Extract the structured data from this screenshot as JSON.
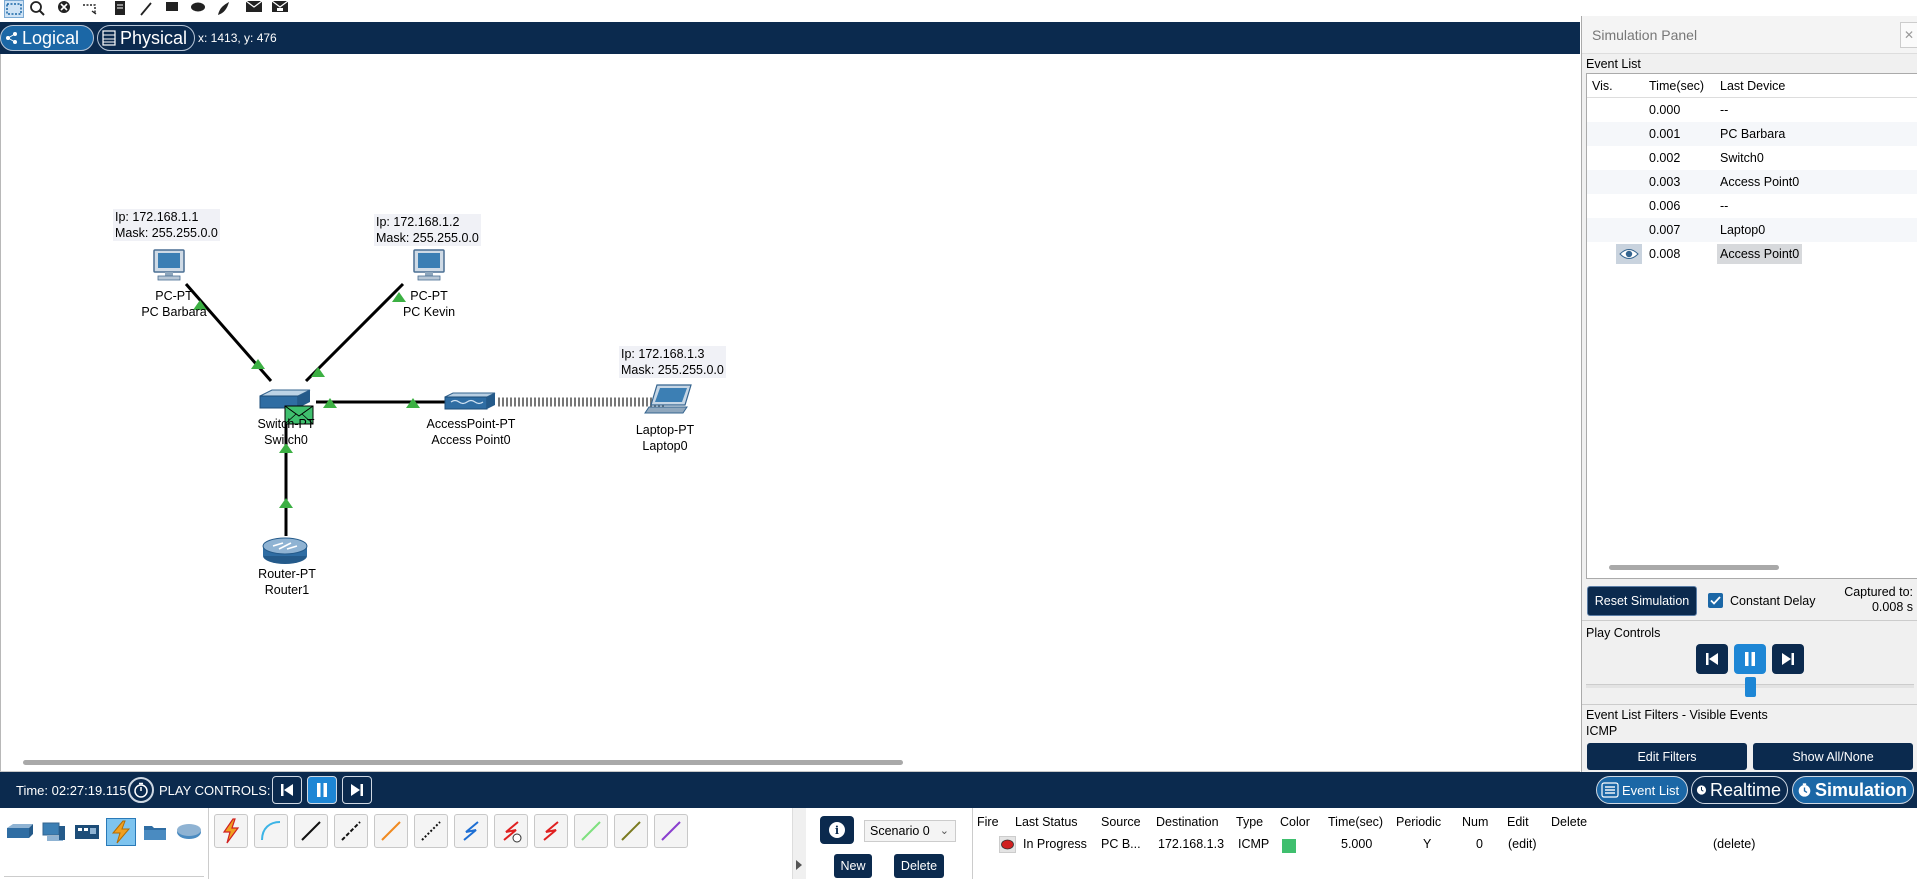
{
  "mode_bar": {
    "logical_label": "Logical",
    "physical_label": "Physical",
    "coords": "x: 1413, y: 476"
  },
  "topology": {
    "devices": [
      {
        "id": "pc-barbara",
        "type_label": "PC-PT",
        "name": "PC Barbara",
        "ip": "Ip: 172.168.1.1",
        "mask": "Mask: 255.255.0.0"
      },
      {
        "id": "pc-kevin",
        "type_label": "PC-PT",
        "name": "PC Kevin",
        "ip": "Ip: 172.168.1.2",
        "mask": "Mask: 255.255.0.0"
      },
      {
        "id": "switch0",
        "type_label": "Switch-PT",
        "name": "Switch0"
      },
      {
        "id": "access-point0",
        "type_label": "AccessPoint-PT",
        "name": "Access Point0"
      },
      {
        "id": "laptop0",
        "type_label": "Laptop-PT",
        "name": "Laptop0",
        "ip": "Ip: 172.168.1.3",
        "mask": "Mask: 255.255.0.0"
      },
      {
        "id": "router1",
        "type_label": "Router-PT",
        "name": "Router1"
      }
    ],
    "link_color": "#000000",
    "link_light_color": "#3cb043"
  },
  "sim_panel": {
    "title": "Simulation Panel",
    "close": "✕",
    "event_list_label": "Event List",
    "columns": {
      "vis": "Vis.",
      "time": "Time(sec)",
      "last_device": "Last Device"
    },
    "events": [
      {
        "time": "0.000",
        "last_device": "--"
      },
      {
        "time": "0.001",
        "last_device": "PC Barbara"
      },
      {
        "time": "0.002",
        "last_device": "Switch0"
      },
      {
        "time": "0.003",
        "last_device": "Access Point0"
      },
      {
        "time": "0.006",
        "last_device": "--"
      },
      {
        "time": "0.007",
        "last_device": "Laptop0"
      },
      {
        "time": "0.008",
        "last_device": "Access Point0"
      }
    ],
    "reset_label": "Reset Simulation",
    "constant_delay_label": "Constant Delay",
    "captured_label": "Captured to:",
    "captured_value": "0.008 s",
    "play_controls_label": "Play Controls",
    "playback_position": 0.5,
    "filters_label": "Event List Filters - Visible Events",
    "filters_value": "ICMP",
    "edit_filters_label": "Edit Filters",
    "show_all_label": "Show All/None"
  },
  "bottom_bar": {
    "time": "Time: 02:27:19.115",
    "play_controls": "PLAY CONTROLS:",
    "event_list_tab": "Event List",
    "realtime_tab": "Realtime",
    "simulation_tab": "Simulation"
  },
  "scenario": {
    "info": "i",
    "selected": "Scenario 0",
    "new_label": "New",
    "delete_label": "Delete"
  },
  "pdu_list": {
    "columns": {
      "fire": "Fire",
      "status": "Last Status",
      "source": "Source",
      "destination": "Destination",
      "type": "Type",
      "color": "Color",
      "time": "Time(sec)",
      "periodic": "Periodic",
      "num": "Num",
      "edit": "Edit",
      "delete": "Delete"
    },
    "rows": [
      {
        "status": "In Progress",
        "source": "PC B...",
        "destination": "172.168.1.3",
        "type": "ICMP",
        "color": "#3fbf6e",
        "time": "5.000",
        "periodic": "Y",
        "num": "0",
        "edit": "(edit)",
        "delete": "(delete)"
      }
    ]
  },
  "colors": {
    "navy": "#0b2a4e",
    "accent_blue": "#1b67a6",
    "active_blue": "#1d86d5"
  }
}
